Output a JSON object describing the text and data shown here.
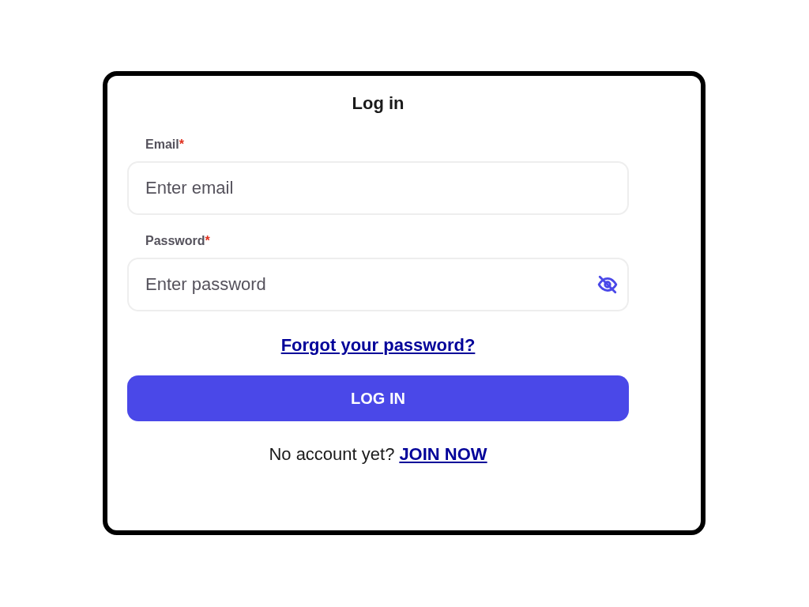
{
  "title": "Log in",
  "fields": [
    {
      "kind": "email",
      "label": "Email",
      "required_mark": "*",
      "placeholder": "Enter email"
    },
    {
      "kind": "password",
      "label": "Password",
      "required_mark": "*",
      "placeholder": "Enter password",
      "password_visible": false
    }
  ],
  "forgot_link": "Forgot your password?",
  "submit_button": "LOG IN",
  "signup": {
    "prompt": "No account yet?",
    "link": "JOIN NOW"
  }
}
